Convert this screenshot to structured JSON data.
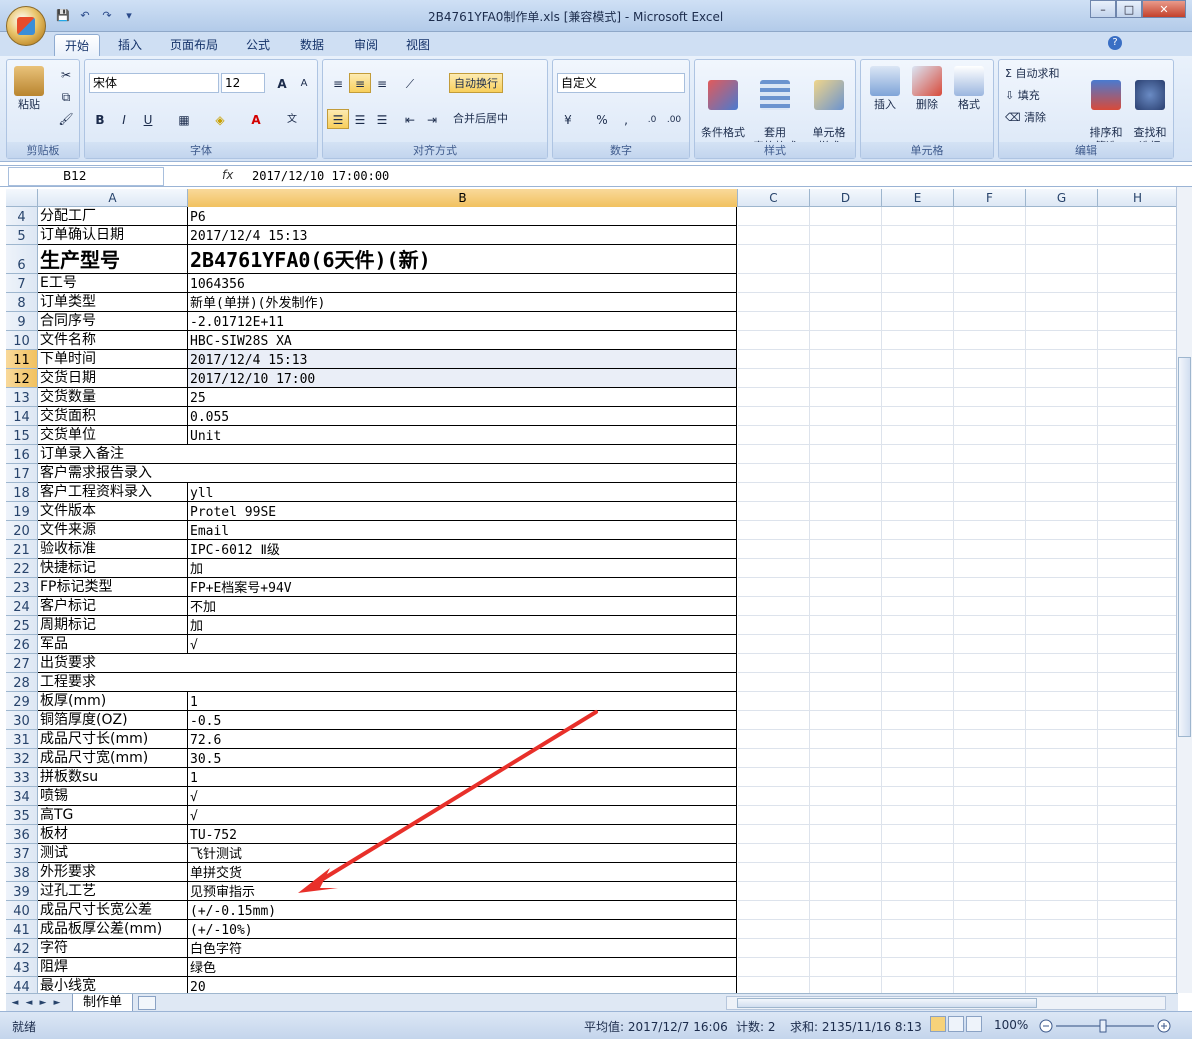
{
  "window": {
    "title": "2B4761YFA0制作单.xls  [兼容模式] - Microsoft Excel",
    "minimize": "–",
    "restore": "□",
    "close": "✕"
  },
  "ribbon_tabs": [
    "开始",
    "插入",
    "页面布局",
    "公式",
    "数据",
    "审阅",
    "视图"
  ],
  "ribbon": {
    "clipboard": {
      "paste": "粘贴",
      "label": "剪贴板"
    },
    "font": {
      "name": "宋体",
      "size": "12",
      "bold": "B",
      "italic": "I",
      "underline": "U",
      "grow": "A",
      "shrink": "A",
      "label": "字体"
    },
    "alignment": {
      "wrap": "自动换行",
      "merge": "合并后居中",
      "label": "对齐方式"
    },
    "number": {
      "format": "自定义",
      "percent": "%",
      "comma": ",",
      "label": "数字"
    },
    "styles": {
      "conditional": "条件格式",
      "table": "套用\n表格格式",
      "cell": "单元格\n样式",
      "label": "样式"
    },
    "cells": {
      "insert": "插入",
      "delete": "删除",
      "format": "格式",
      "label": "单元格"
    },
    "editing": {
      "autosum": "自动求和",
      "fill": "填充",
      "clear": "清除",
      "sort": "排序和\n筛选",
      "find": "查找和\n选择",
      "label": "编辑"
    }
  },
  "formula_bar": {
    "name_box": "B12",
    "fx": "fx",
    "content": "2017/12/10  17:00:00"
  },
  "columns": [
    "A",
    "B",
    "C",
    "D",
    "E",
    "F",
    "G",
    "H"
  ],
  "selected_column": "B",
  "rows": [
    {
      "n": "4",
      "a": "分配工厂",
      "b": "P6"
    },
    {
      "n": "5",
      "a": "订单确认日期",
      "b": "2017/12/4 15:13"
    },
    {
      "n": "6",
      "a": "生产型号",
      "b": "2B4761YFA0(6天件)(新)"
    },
    {
      "n": "7",
      "a": "E工号",
      "b": "1064356"
    },
    {
      "n": "8",
      "a": "订单类型",
      "b": "新单(单拼)(外发制作)"
    },
    {
      "n": "9",
      "a": "合同序号",
      "b": "-2.01712E+11"
    },
    {
      "n": "10",
      "a": "文件名称",
      "b": "HBC-SIW28S XA"
    },
    {
      "n": "11",
      "a": "下单时间",
      "b": "2017/12/4 15:13"
    },
    {
      "n": "12",
      "a": "交货日期",
      "b": "2017/12/10 17:00"
    },
    {
      "n": "13",
      "a": "交货数量",
      "b": "25"
    },
    {
      "n": "14",
      "a": "交货面积",
      "b": "0.055"
    },
    {
      "n": "15",
      "a": "交货单位",
      "b": "Unit"
    },
    {
      "n": "16",
      "a": "订单录入备注",
      "b": ""
    },
    {
      "n": "17",
      "a": "客户需求报告录入",
      "b": ""
    },
    {
      "n": "18",
      "a": "客户工程资料录入",
      "b": "yll"
    },
    {
      "n": "19",
      "a": "文件版本",
      "b": "Protel 99SE"
    },
    {
      "n": "20",
      "a": "文件来源",
      "b": "Email"
    },
    {
      "n": "21",
      "a": "验收标准",
      "b": "IPC-6012 Ⅱ级"
    },
    {
      "n": "22",
      "a": "快捷标记",
      "b": "加"
    },
    {
      "n": "23",
      "a": "FP标记类型",
      "b": "FP+E档案号+94V"
    },
    {
      "n": "24",
      "a": "客户标记",
      "b": "不加"
    },
    {
      "n": "25",
      "a": "周期标记",
      "b": "加"
    },
    {
      "n": "26",
      "a": "军品",
      "b": "√"
    },
    {
      "n": "27",
      "a": "出货要求",
      "b": ""
    },
    {
      "n": "28",
      "a": "工程要求",
      "b": ""
    },
    {
      "n": "29",
      "a": "板厚(mm)",
      "b": "1"
    },
    {
      "n": "30",
      "a": "铜箔厚度(OZ)",
      "b": "-0.5"
    },
    {
      "n": "31",
      "a": "成品尺寸长(mm)",
      "b": "72.6"
    },
    {
      "n": "32",
      "a": "成品尺寸宽(mm)",
      "b": "30.5"
    },
    {
      "n": "33",
      "a": "拼板数su",
      "b": "1"
    },
    {
      "n": "34",
      "a": "喷锡",
      "b": "√"
    },
    {
      "n": "35",
      "a": "高TG",
      "b": "√"
    },
    {
      "n": "36",
      "a": "板材",
      "b": "TU-752"
    },
    {
      "n": "37",
      "a": "测试",
      "b": "飞针测试"
    },
    {
      "n": "38",
      "a": "外形要求",
      "b": "单拼交货"
    },
    {
      "n": "39",
      "a": "过孔工艺",
      "b": "见预审指示"
    },
    {
      "n": "40",
      "a": "成品尺寸长宽公差",
      "b": "(+/-0.15mm)"
    },
    {
      "n": "41",
      "a": "成品板厚公差(mm)",
      "b": "(+/-10%)"
    },
    {
      "n": "42",
      "a": "字符",
      "b": "白色字符"
    },
    {
      "n": "43",
      "a": "阻焊",
      "b": "绿色"
    },
    {
      "n": "44",
      "a": "最小线宽",
      "b": "20"
    }
  ],
  "sheet_tab": "制作单",
  "status": {
    "ready": "就绪",
    "average": "平均值: 2017/12/7 16:06",
    "count": "计数: 2",
    "sum": "求和: 2135/11/16 8:13",
    "zoom": "100%"
  },
  "annotation": {
    "arrow_color": "#e8302a"
  }
}
